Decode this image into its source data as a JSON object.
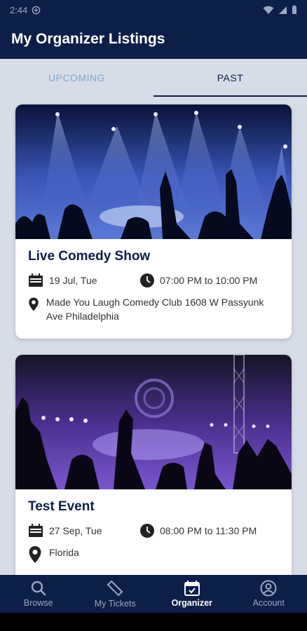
{
  "status_bar": {
    "time": "2:44"
  },
  "app_bar": {
    "title": "My Organizer Listings"
  },
  "tabs": [
    {
      "label": "UPCOMING"
    },
    {
      "label": "PAST"
    }
  ],
  "events": [
    {
      "title": "Live Comedy Show",
      "date": "19 Jul, Tue",
      "time": "07:00 PM to 10:00 PM",
      "location": "Made You Laugh Comedy Club 1608 W Passyunk Ave Philadelphia"
    },
    {
      "title": "Test Event",
      "date": "27 Sep, Tue",
      "time": "08:00 PM to 11:30 PM",
      "location": "Florida"
    }
  ],
  "bottom_nav": [
    {
      "label": "Browse",
      "icon": "search-icon"
    },
    {
      "label": "My Tickets",
      "icon": "ticket-icon"
    },
    {
      "label": "Organizer",
      "icon": "calendar-check-icon"
    },
    {
      "label": "Account",
      "icon": "account-icon"
    }
  ],
  "colors": {
    "primary": "#0d1e48",
    "tab_inactive": "#7fa3d1",
    "background": "#d6dde8"
  }
}
